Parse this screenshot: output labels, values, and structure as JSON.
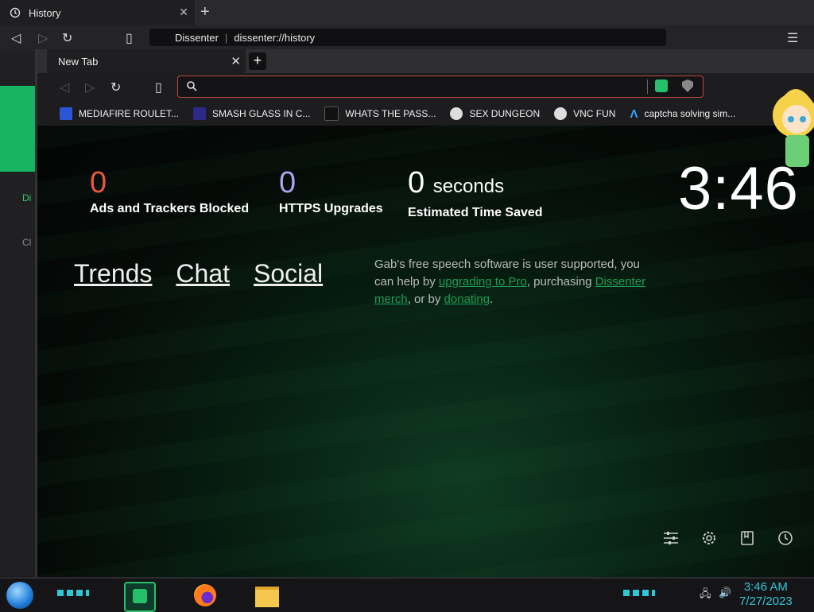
{
  "back_window": {
    "tab_title": "History",
    "address_site": "Dissenter",
    "address_url": "dissenter://history",
    "sidebar_items": [
      "Di",
      "Cl"
    ]
  },
  "front_window": {
    "tab_title": "New Tab",
    "address_placeholder": "",
    "bookmarks": [
      {
        "label": "MEDIAFIRE ROULET...",
        "icon": "mediafire-icon",
        "color": "#2a56d6"
      },
      {
        "label": "SMASH GLASS IN C...",
        "icon": "smash-glass-icon",
        "color": "#2e2a8a"
      },
      {
        "label": "WHATS THE PASS...",
        "icon": "lock-icon",
        "color": "#111111"
      },
      {
        "label": "SEX DUNGEON",
        "icon": "skull-icon",
        "color": "#dddddd"
      },
      {
        "label": "VNC FUN",
        "icon": "skull-icon",
        "color": "#dddddd"
      },
      {
        "label": "captcha solving sim...",
        "icon": "lambda-icon",
        "color": "#3aa0ff"
      }
    ]
  },
  "newtab": {
    "stats": [
      {
        "value": "0",
        "suffix": "",
        "label": "Ads and Trackers Blocked",
        "color": "#e9583a"
      },
      {
        "value": "0",
        "suffix": "",
        "label": "HTTPS Upgrades",
        "color": "#a9a4f0"
      },
      {
        "value": "0",
        "suffix": "seconds",
        "label": "Estimated Time Saved",
        "color": "#ffffff"
      }
    ],
    "clock": "3:46",
    "links": [
      "Trends",
      "Chat",
      "Social"
    ],
    "support": {
      "p1": "Gab's free speech software is user supported, you can help by ",
      "link1": "upgrading to Pro",
      "p2": ", purchasing ",
      "link2": "Dissenter merch",
      "p3": ", or by ",
      "link3": "donating",
      "p4": "."
    }
  },
  "taskbar": {
    "time": "3:46 AM",
    "date": "7/27/2023"
  },
  "colors": {
    "accent_green": "#27c06a",
    "clock_cyan": "#2fc6d6"
  }
}
